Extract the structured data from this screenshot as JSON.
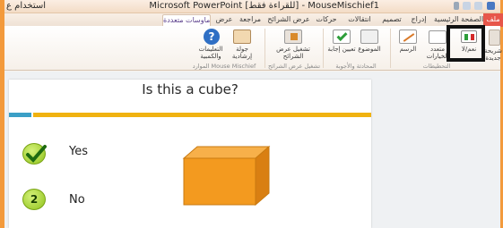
{
  "window": {
    "title": "MouseMischief1 - [للقراءة فقط] Microsoft PowerPoint",
    "title_right": "استخدام ع"
  },
  "tabs": {
    "file": "ملف",
    "items": [
      "الصفحة الرئيسية",
      "إدراج",
      "تصميم",
      "انتقالات",
      "حركات",
      "عرض الشرائح",
      "مراجعة",
      "عرض",
      "ماوسات متعددة"
    ],
    "active": "ماوسات متعددة"
  },
  "ribbon": {
    "buttons": {
      "yes_no": "نعم/لا",
      "multiple_answer": "متعدد الخيارات",
      "drawing": "الرسم",
      "topic": "الموضوع",
      "set_answer": "تعيين إجابة",
      "start_slideshow": "تشغيل عرض الشرائح",
      "tour": "جولة إرشادية",
      "help": "التعليمات والكمبية",
      "new_slide": "شريحة جديدة"
    },
    "groups": {
      "questions": "التحطيطات",
      "answers": "المحادثة والأجوبة",
      "slideshow": "تشغيل عرض الشرائح",
      "help": "الموارد Mouse Mischief"
    }
  },
  "slide": {
    "title": "Is this a cube?",
    "options": [
      {
        "number": "",
        "label": "Yes",
        "correct": true
      },
      {
        "number": "2",
        "label": "No",
        "correct": false
      }
    ],
    "cube_color": "#f39a1f"
  },
  "colors": {
    "accent": "#f39a3c",
    "gold": "#f0b211",
    "blue": "#3b9fc6"
  }
}
